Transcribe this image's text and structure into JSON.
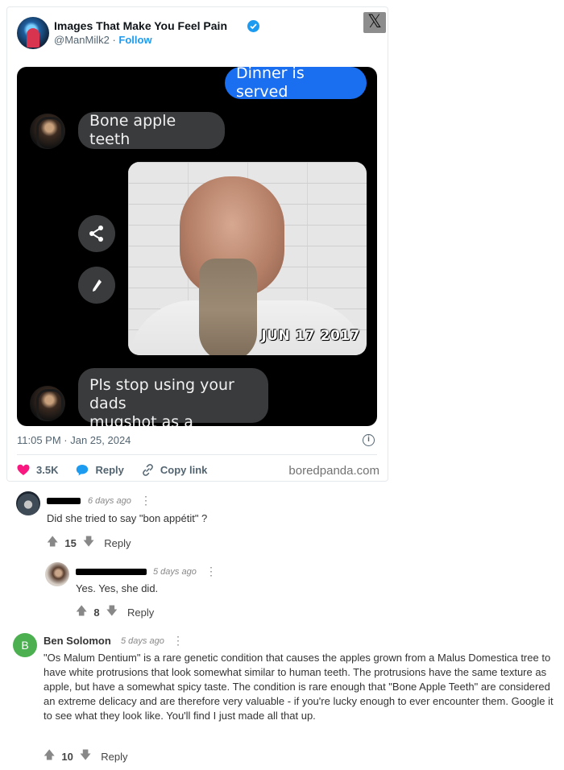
{
  "tweet": {
    "display_name": "Images That Make You Feel Pain",
    "handle": "@ManMilk2",
    "separator": "·",
    "follow_label": "Follow",
    "platform_logo": "𝕏",
    "chat": {
      "sent_message": "Dinner is served",
      "received_message_1": "Bone apple teeth",
      "received_message_2_line1": "Pls stop using your dads",
      "received_message_2_line2": "mugshot as a reaction pic",
      "photo_date_stamp": "JUN 17 2017"
    },
    "timestamp": "11:05 PM · Jan 25, 2024",
    "likes": "3.5K",
    "reply_label": "Reply",
    "copy_link_label": "Copy link",
    "source": "boredpanda.com",
    "colors": {
      "accent": "#1d9bf0",
      "like": "#f91880",
      "bubble_blue": "#1a6ef0"
    }
  },
  "comments": [
    {
      "name": "",
      "time": "6 days ago",
      "text": "Did she tried to say \"bon appétit\" ?",
      "votes": "15",
      "reply_label": "Reply"
    },
    {
      "name": "",
      "time": "5 days ago",
      "text": "Yes. Yes, she did.",
      "votes": "8",
      "reply_label": "Reply"
    },
    {
      "name": "Ben Solomon",
      "avatar_letter": "B",
      "avatar_color": "#4caf50",
      "time": "5 days ago",
      "text": "\"Os Malum Dentium\" is a rare genetic condition that causes the apples grown from a Malus Domestica tree to have white protrusions that look somewhat similar to human teeth. The protrusions have the same texture as apple, but have a somewhat spicy taste. The condition is rare enough that \"Bone Apple Teeth\" are considered an extreme delicacy and are therefore very valuable - if you're lucky enough to ever encounter them. Google it to see what they look like. You'll find I just made all that up.",
      "votes": "10",
      "reply_label": "Reply"
    }
  ]
}
